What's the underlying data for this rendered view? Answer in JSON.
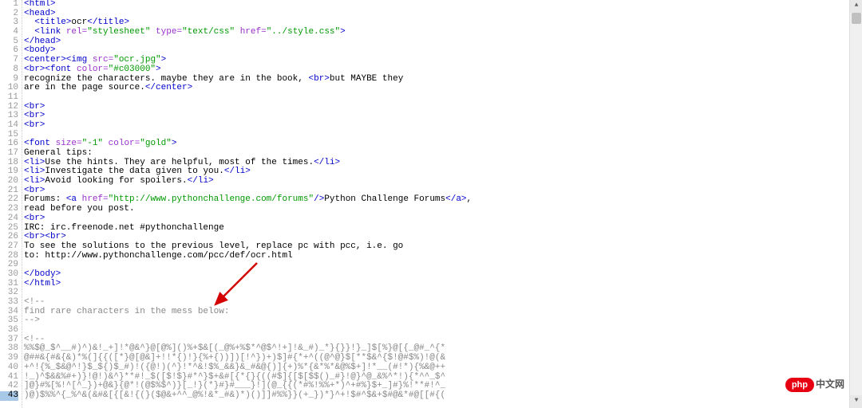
{
  "lines": [
    {
      "n": 1,
      "seg": [
        {
          "c": "tag",
          "t": "<html>"
        }
      ]
    },
    {
      "n": 2,
      "seg": [
        {
          "c": "tag",
          "t": "<head>"
        }
      ]
    },
    {
      "n": 3,
      "seg": [
        {
          "c": "text",
          "t": "  "
        },
        {
          "c": "tag",
          "t": "<title>"
        },
        {
          "c": "text",
          "t": "ocr"
        },
        {
          "c": "tag",
          "t": "</title>"
        }
      ]
    },
    {
      "n": 4,
      "seg": [
        {
          "c": "text",
          "t": "  "
        },
        {
          "c": "tag",
          "t": "<link "
        },
        {
          "c": "attr-n",
          "t": "rel="
        },
        {
          "c": "attr-v",
          "t": "\"stylesheet\""
        },
        {
          "c": "tag",
          "t": " "
        },
        {
          "c": "attr-n",
          "t": "type="
        },
        {
          "c": "attr-v",
          "t": "\"text/css\""
        },
        {
          "c": "tag",
          "t": " "
        },
        {
          "c": "attr-n",
          "t": "href="
        },
        {
          "c": "attr-v",
          "t": "\"../style.css\""
        },
        {
          "c": "tag",
          "t": ">"
        }
      ]
    },
    {
      "n": 5,
      "seg": [
        {
          "c": "tag",
          "t": "</head>"
        }
      ]
    },
    {
      "n": 6,
      "seg": [
        {
          "c": "tag",
          "t": "<body>"
        }
      ]
    },
    {
      "n": 7,
      "seg": [
        {
          "c": "tag",
          "t": "<center><img "
        },
        {
          "c": "attr-n",
          "t": "src="
        },
        {
          "c": "attr-v",
          "t": "\"ocr.jpg\""
        },
        {
          "c": "tag",
          "t": ">"
        }
      ]
    },
    {
      "n": 8,
      "seg": [
        {
          "c": "tag",
          "t": "<br><font "
        },
        {
          "c": "attr-n",
          "t": "color="
        },
        {
          "c": "attr-v",
          "t": "\"#c03000\""
        },
        {
          "c": "tag",
          "t": ">"
        }
      ]
    },
    {
      "n": 9,
      "seg": [
        {
          "c": "text",
          "t": "recognize the characters. maybe they are in the book, "
        },
        {
          "c": "tag",
          "t": "<br>"
        },
        {
          "c": "text",
          "t": "but MAYBE they"
        }
      ]
    },
    {
      "n": 10,
      "seg": [
        {
          "c": "text",
          "t": "are in the page source."
        },
        {
          "c": "tag",
          "t": "</center>"
        }
      ]
    },
    {
      "n": 11,
      "seg": []
    },
    {
      "n": 12,
      "seg": [
        {
          "c": "tag",
          "t": "<br>"
        }
      ]
    },
    {
      "n": 13,
      "seg": [
        {
          "c": "tag",
          "t": "<br>"
        }
      ]
    },
    {
      "n": 14,
      "seg": [
        {
          "c": "tag",
          "t": "<br>"
        }
      ]
    },
    {
      "n": 15,
      "seg": []
    },
    {
      "n": 16,
      "seg": [
        {
          "c": "tag",
          "t": "<font "
        },
        {
          "c": "attr-n",
          "t": "size="
        },
        {
          "c": "attr-v",
          "t": "\"-1\""
        },
        {
          "c": "tag",
          "t": " "
        },
        {
          "c": "attr-n",
          "t": "color="
        },
        {
          "c": "attr-v",
          "t": "\"gold\""
        },
        {
          "c": "tag",
          "t": ">"
        }
      ]
    },
    {
      "n": 17,
      "seg": [
        {
          "c": "text",
          "t": "General tips:"
        }
      ]
    },
    {
      "n": 18,
      "seg": [
        {
          "c": "tag",
          "t": "<li>"
        },
        {
          "c": "text",
          "t": "Use the hints. They are helpful, most of the times."
        },
        {
          "c": "tag",
          "t": "</li>"
        }
      ]
    },
    {
      "n": 19,
      "seg": [
        {
          "c": "tag",
          "t": "<li>"
        },
        {
          "c": "text",
          "t": "Investigate the data given to you."
        },
        {
          "c": "tag",
          "t": "</li>"
        }
      ]
    },
    {
      "n": 20,
      "seg": [
        {
          "c": "tag",
          "t": "<li>"
        },
        {
          "c": "text",
          "t": "Avoid looking for spoilers."
        },
        {
          "c": "tag",
          "t": "</li>"
        }
      ]
    },
    {
      "n": 21,
      "seg": [
        {
          "c": "tag",
          "t": "<br>"
        }
      ]
    },
    {
      "n": 22,
      "seg": [
        {
          "c": "text",
          "t": "Forums: "
        },
        {
          "c": "tag",
          "t": "<a "
        },
        {
          "c": "attr-n",
          "t": "href="
        },
        {
          "c": "attr-v",
          "t": "\"http://www.pythonchallenge.com/forums\""
        },
        {
          "c": "tag",
          "t": "/>"
        },
        {
          "c": "text",
          "t": "Python Challenge Forums"
        },
        {
          "c": "tag",
          "t": "</a>"
        },
        {
          "c": "text",
          "t": ","
        }
      ]
    },
    {
      "n": 23,
      "seg": [
        {
          "c": "text",
          "t": "read before you post."
        }
      ]
    },
    {
      "n": 24,
      "seg": [
        {
          "c": "tag",
          "t": "<br>"
        }
      ]
    },
    {
      "n": 25,
      "seg": [
        {
          "c": "text",
          "t": "IRC: irc.freenode.net #pythonchallenge"
        }
      ]
    },
    {
      "n": 26,
      "seg": [
        {
          "c": "tag",
          "t": "<br><br>"
        }
      ]
    },
    {
      "n": 27,
      "seg": [
        {
          "c": "text",
          "t": "To see the solutions to the previous level, replace pc with pcc, i.e. go"
        }
      ]
    },
    {
      "n": 28,
      "seg": [
        {
          "c": "text",
          "t": "to: http://www.pythonchallenge.com/pcc/def/ocr.html"
        }
      ]
    },
    {
      "n": 29,
      "seg": []
    },
    {
      "n": 30,
      "seg": [
        {
          "c": "tag",
          "t": "</body>"
        }
      ]
    },
    {
      "n": 31,
      "seg": [
        {
          "c": "tag",
          "t": "</html>"
        }
      ]
    },
    {
      "n": 32,
      "seg": []
    },
    {
      "n": 33,
      "seg": [
        {
          "c": "comment",
          "t": "<!--"
        }
      ]
    },
    {
      "n": 34,
      "seg": [
        {
          "c": "comment",
          "t": "find rare characters in the mess below:"
        }
      ]
    },
    {
      "n": 35,
      "seg": [
        {
          "c": "comment",
          "t": "-->"
        }
      ]
    },
    {
      "n": 36,
      "seg": []
    },
    {
      "n": 37,
      "seg": [
        {
          "c": "comment",
          "t": "<!--"
        }
      ]
    },
    {
      "n": 38,
      "seg": [
        {
          "c": "comment",
          "t": "%%$@_$^__#)^)&!_+]!*@&^}@[@%]()%+$&[(_@%+%$*^@$^!+]!&_#)_*}{}}!}_]$[%}@[{_@#_^{*"
        }
      ]
    },
    {
      "n": 39,
      "seg": [
        {
          "c": "comment",
          "t": "@##&{#&{&)*%(]{{([*}@[@&]+!!*{)!}{%+{))])[!^})+)$]#{*+^((@^@}$[**$&^{$!@#$%)!@(&"
        }
      ]
    },
    {
      "n": 40,
      "seg": [
        {
          "c": "comment",
          "t": "+^!{%_$&@^!}$_${)$_#)!({@!)(^}!*^&!$%_&&}&_#&@{)]{+)%*{&*%*&@%$+]!*__(#!*){%&@++"
        }
      ]
    },
    {
      "n": 41,
      "seg": [
        {
          "c": "comment",
          "t": "!_)^$&&%#+)}!@!)&^}**#!_$([$!$}#*^}$+&#[{*{}{((#$]{[$[$$()_#}!@}^@_&%^*!){*^^_$^"
        }
      ]
    },
    {
      "n": 42,
      "seg": [
        {
          "c": "comment",
          "t": "]@}#%[%!^[^_})+@&}{@*!(@$%$^)}[_!}(*}#}#___}!](@_{{(*#%!%%+*)^+#%}$+_]#}%!**#!^_"
        }
      ]
    },
    {
      "n": 43,
      "seg": [
        {
          "c": "comment",
          "t": ")@)$%%^{_%^&(&#&[{[&!{(}($@&+^^_@%!&*_#&)*)()]]#%%}}(+_})*}^+!$#^$&+$#@&*#@[[#{("
        }
      ],
      "current": true
    }
  ],
  "logo": {
    "pill": "php",
    "cn": "中文网"
  }
}
